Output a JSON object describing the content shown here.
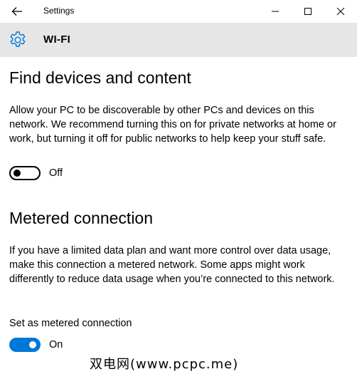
{
  "window": {
    "title": "Settings",
    "back_icon": "back-arrow-icon",
    "controls": [
      "minimize-icon",
      "maximize-icon",
      "close-icon"
    ]
  },
  "header": {
    "icon": "gear-icon",
    "title": "WI-FI",
    "background": "#e6e6e6"
  },
  "sections": {
    "find_devices": {
      "title": "Find devices and content",
      "description": "Allow your PC to be discoverable by other PCs and devices on this network. We recommend turning this on for private networks at home or work, but turning it off for public networks to help keep your stuff safe.",
      "toggle_state": "Off"
    },
    "metered": {
      "title": "Metered connection",
      "description": "If you have a limited data plan and want more control over data usage, make this connection a metered network. Some apps might work differently to reduce data usage when you’re connected to this network.",
      "setting_label": "Set as metered connection",
      "toggle_state": "On"
    }
  },
  "watermark": "双电网(www.pcpc.me)",
  "colors": {
    "accent": "#0078d7"
  }
}
